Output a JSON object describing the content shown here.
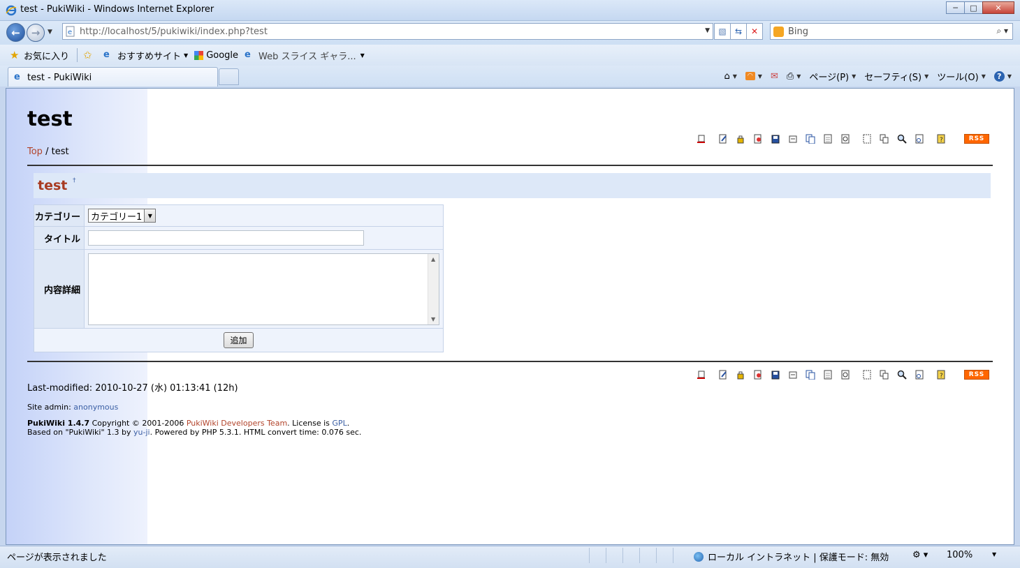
{
  "window": {
    "title": "test - PukiWiki - Windows Internet Explorer",
    "controls": {
      "minimize": "─",
      "maximize": "□",
      "close": "✕"
    }
  },
  "address_bar": {
    "url": "http://localhost/5/pukiwiki/index.php?test"
  },
  "search": {
    "provider": "Bing"
  },
  "favorites": {
    "label": "お気に入り",
    "items": [
      "おすすめサイト",
      "Google",
      "Web スライス ギャラ..."
    ]
  },
  "tab": {
    "label": "test - PukiWiki"
  },
  "commands": [
    "ページ(P)",
    "セーフティ(S)",
    "ツール(O)"
  ],
  "page": {
    "site_title": "test",
    "breadcrumb": {
      "top": "Top",
      "separator": " / ",
      "current": "test"
    },
    "toolbar_rss": "RSS",
    "heading": "test",
    "heading_anchor": "†",
    "form": {
      "category_label": "カテゴリー",
      "category_value": "カテゴリー1",
      "title_label": "タイトル",
      "title_value": "",
      "detail_label": "内容詳細",
      "detail_value": "",
      "submit": "追加"
    },
    "last_modified": "Last-modified: 2010-10-27 (水) 01:13:41 (12h)",
    "site_admin_label": "Site admin: ",
    "site_admin_name": "anonymous",
    "footer": {
      "line1_prefix": "PukiWiki 1.4.7",
      "line1_copyright": " Copyright © 2001-2006 ",
      "line1_team": "PukiWiki Developers Team",
      "line1_license": ". License is ",
      "line1_gpl": "GPL",
      "line1_end": ".",
      "line2_prefix": "Based on \"PukiWiki\" 1.3 by ",
      "line2_author": "yu-ji",
      "line2_rest": ". Powered by PHP 5.3.1. HTML convert time: 0.076 sec."
    }
  },
  "status": {
    "message": "ページが表示されました",
    "zone": "ローカル イントラネット | 保護モード: 無効",
    "zoom": "100%"
  },
  "colors": {
    "link_red": "#b2442b",
    "link_blue": "#3b5fa4",
    "heading_bg": "#dde8f8",
    "rss": "#ff6600"
  }
}
